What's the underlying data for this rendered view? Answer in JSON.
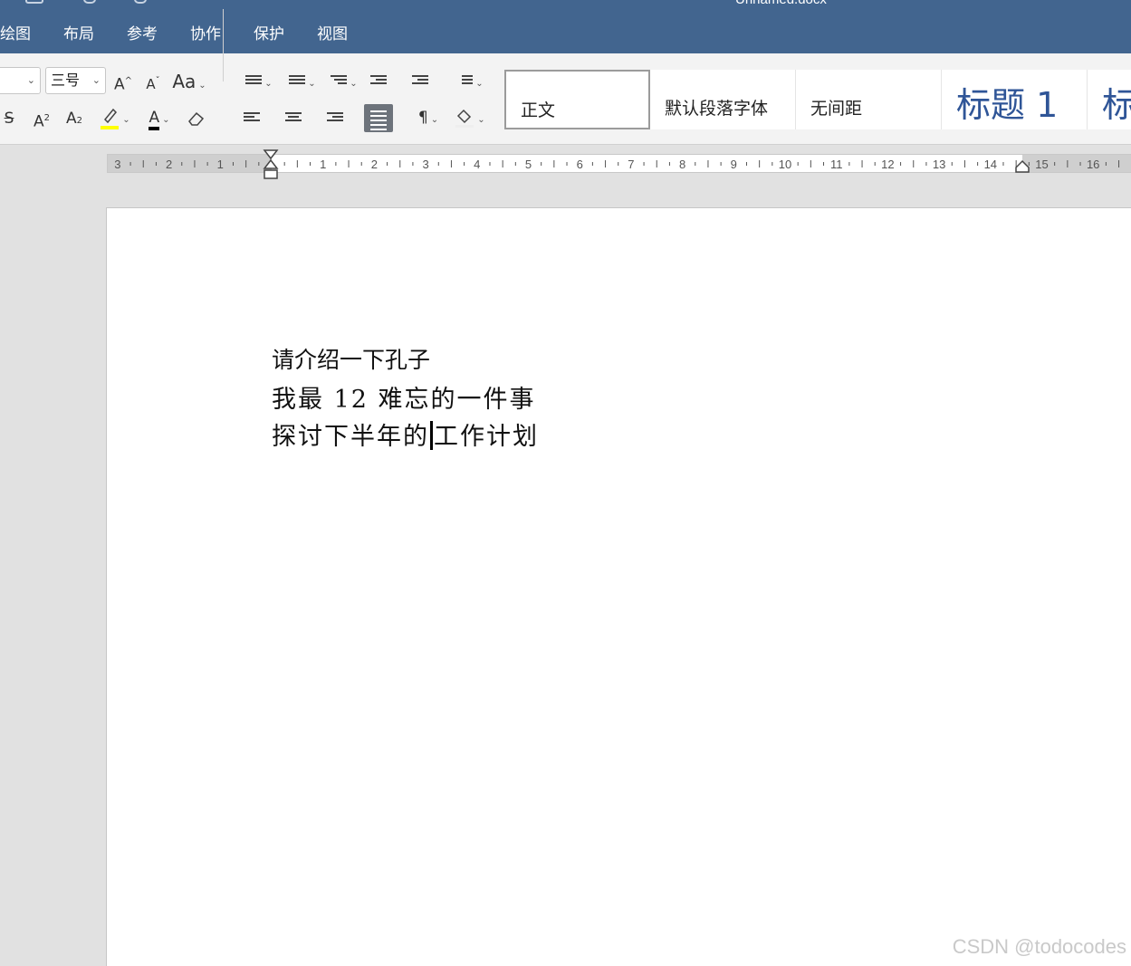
{
  "titlebar": {
    "document_title": "Unnamed.docx"
  },
  "menu": {
    "items": [
      "绘图",
      "布局",
      "参考",
      "协作",
      "保护",
      "视图"
    ]
  },
  "ribbon": {
    "font_name": "",
    "font_size": "三号",
    "grow_font": "A",
    "shrink_font": "A",
    "change_case": "Aa",
    "strikethrough": "S",
    "superscript": "A",
    "subscript": "A",
    "font_color_letter": "A",
    "pilcrow": "¶",
    "styles": [
      "正文",
      "默认段落字体",
      "无间距",
      "标题 1",
      "标"
    ]
  },
  "ruler": {
    "labels": [
      "3",
      "2",
      "1",
      "1",
      "2",
      "3",
      "4",
      "5",
      "6",
      "7",
      "8",
      "9",
      "10",
      "11",
      "12",
      "13",
      "14",
      "15",
      "16"
    ]
  },
  "document": {
    "lines": [
      "请介绍一下孔子",
      "我最 12 难忘的一件事"
    ],
    "line3_before_cursor": "探讨下半年的",
    "line3_after_cursor": "工作计划"
  },
  "watermark": "CSDN @todocodes",
  "colors": {
    "title_bar": "#42658f",
    "highlight": "#ffff00",
    "heading": "#2f5597"
  }
}
